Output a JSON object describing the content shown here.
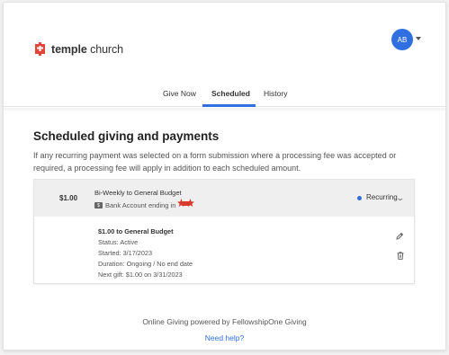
{
  "header": {
    "brand_part1": "temple",
    "brand_part2": " church",
    "avatar_initials": "AB",
    "accent_color": "#2f6fe0",
    "logo_color": "#e0463a"
  },
  "tabs": [
    {
      "label": "Give Now",
      "active": false
    },
    {
      "label": "Scheduled",
      "active": true
    },
    {
      "label": "History",
      "active": false
    }
  ],
  "section": {
    "title": "Scheduled giving and payments",
    "description": "If any recurring payment was selected on a form submission where a processing fee was accepted or required, a processing fee will apply in addition to each scheduled amount."
  },
  "schedule": {
    "amount": "$1.00",
    "title": "Bi-Weekly to General Budget",
    "bank_icon_text": "$",
    "bank_label": "Bank Account ending in",
    "status": "Recurring",
    "detail_title": "$1.00 to General Budget",
    "detail_status": "Status: Active",
    "detail_started": "Started: 3/17/2023",
    "detail_duration": "Duration: Ongoing / No end date",
    "detail_next": "Next gift: $1.00 on 3/31/2023"
  },
  "footer": {
    "powered_by": "Online Giving powered by FellowshipOne Giving",
    "help_link": "Need help?"
  }
}
